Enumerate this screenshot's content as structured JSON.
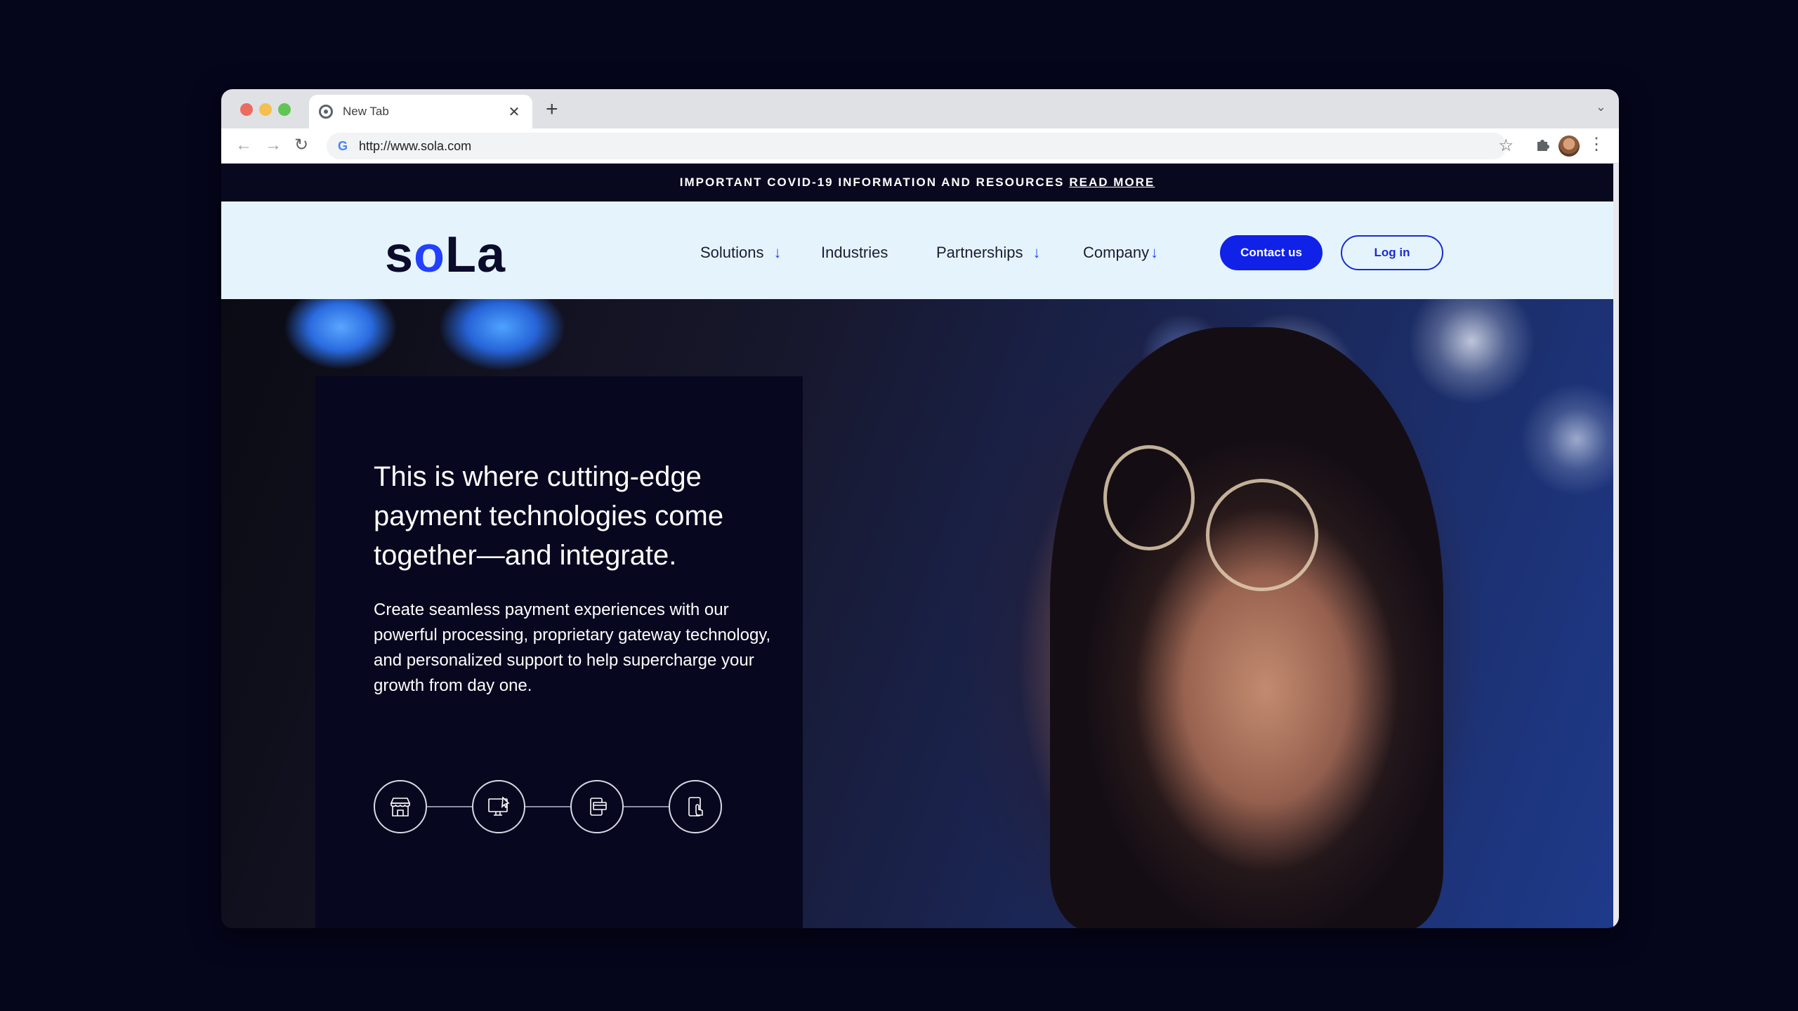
{
  "browser": {
    "tab_title": "New Tab",
    "tab_close": "✕",
    "new_tab": "+",
    "tab_menu": "⌄",
    "back": "←",
    "forward": "→",
    "reload": "↻",
    "google_g": "G",
    "url": "http://www.sola.com",
    "bookmark": "☆",
    "menu": "⋮"
  },
  "banner": {
    "text": "IMPORTANT COVID-19 INFORMATION AND RESOURCES",
    "link": "READ MORE"
  },
  "header": {
    "logo_s": "s",
    "logo_o": "o",
    "logo_la": "La",
    "nav": [
      {
        "label": "Solutions",
        "arrow": "↓"
      },
      {
        "label": "Industries",
        "arrow": ""
      },
      {
        "label": "Partnerships",
        "arrow": "↓"
      },
      {
        "label": "Company",
        "arrow": "↓"
      }
    ],
    "contact_label": "Contact us",
    "login_label": "Log in"
  },
  "hero": {
    "headline": "This is where cutting-edge payment technologies come together—and integrate.",
    "body": "Create seamless payment experiences with our powerful processing, proprietary gateway technology, and personalized support to help supercharge your growth from day one.",
    "icons": [
      "storefront-icon",
      "desktop-pointer-icon",
      "card-terminal-icon",
      "mobile-tap-icon"
    ]
  },
  "colors": {
    "brand_blue": "#1021e8",
    "navy": "#07071f",
    "header_bg": "#e5f4fc"
  }
}
